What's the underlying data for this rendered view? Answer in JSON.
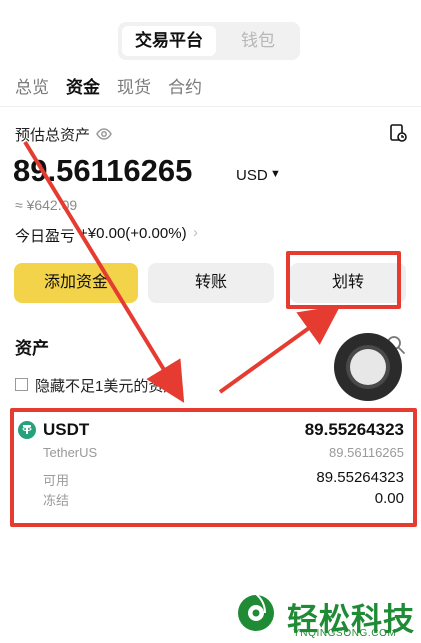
{
  "top_switch": {
    "active": "交易平台",
    "inactive": "钱包"
  },
  "tabs": [
    {
      "label": "总览"
    },
    {
      "label": "资金"
    },
    {
      "label": "现货"
    },
    {
      "label": "合约"
    }
  ],
  "summary": {
    "label": "预估总资产",
    "amount": "89.56116265",
    "currency": "USD",
    "approx": "≈ ¥642.09",
    "pnl_label": "今日盈亏",
    "pnl_value": "+¥0.00(+0.00%)"
  },
  "actions": {
    "deposit": "添加资金",
    "transfer": "转账",
    "internal_transfer": "划转"
  },
  "assets": {
    "title": "资产",
    "hide_small_label": "隐藏不足1美元的资产",
    "item": {
      "symbol": "USDT",
      "name": "TetherUS",
      "balance": "89.55264323",
      "usd_value": "89.56116265",
      "available_label": "可用",
      "available_value": "89.55264323",
      "frozen_label": "冻结",
      "frozen_value": "0.00"
    }
  },
  "watermark": {
    "title": "轻松科技",
    "site": "YNQINGSONG.COM"
  },
  "colors": {
    "accent_yellow": "#F3D34A",
    "annotation_red": "#E53B31",
    "watermark_green": "#1F8B35",
    "tether_green": "#26A17B"
  }
}
